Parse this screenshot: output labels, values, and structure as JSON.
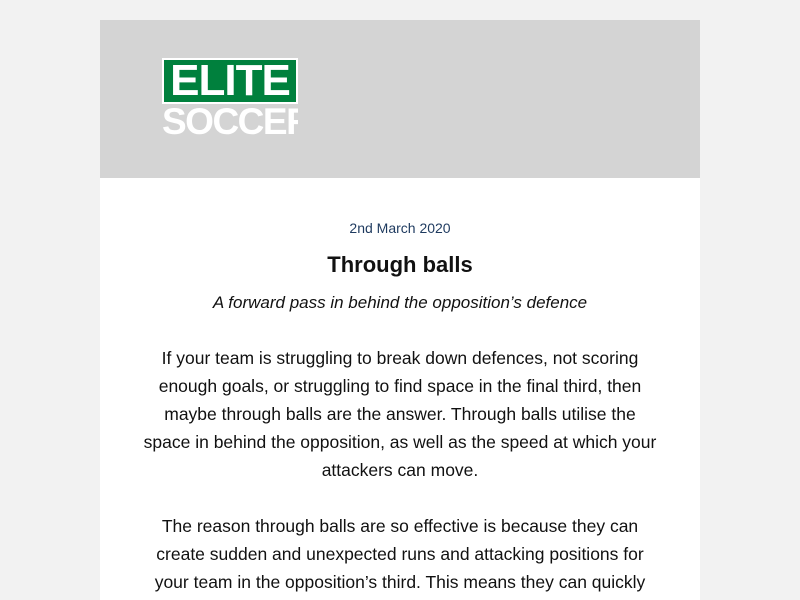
{
  "brand": {
    "logo_line1": "ELITE",
    "logo_line2": "SOCCER",
    "accent_color": "#00803d",
    "header_bg": "#d4d4d4"
  },
  "article": {
    "date": "2nd March 2020",
    "title": "Through balls",
    "subtitle": "A forward pass in behind the opposition’s defence",
    "paragraphs": [
      "If your team is struggling to break down defences, not scoring enough goals, or struggling to find space in the final third, then maybe through balls are the answer. Through balls utilise the space in behind the opposition, as well as the speed at which your attackers can move.",
      "The reason through balls are so effective is because they can create sudden and unexpected runs and attacking positions for your team in the opposition’s third. This means they can quickly"
    ]
  }
}
